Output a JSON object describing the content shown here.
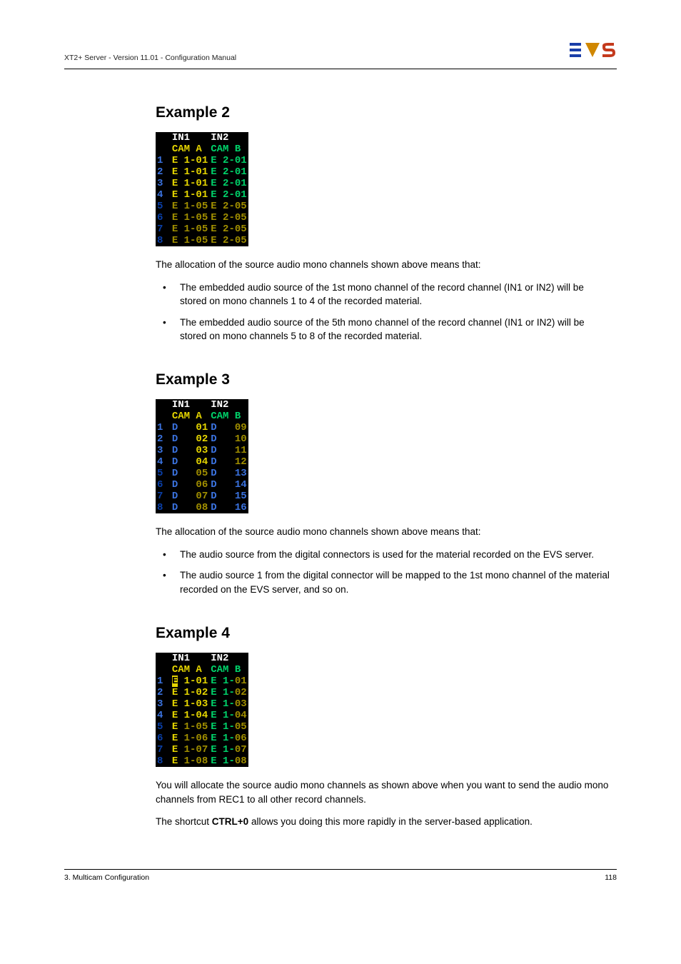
{
  "header": {
    "title": "XT2+ Server - Version 11.01 - Configuration Manual"
  },
  "footer": {
    "left": "3. Multicam Configuration",
    "right": "118"
  },
  "ex2": {
    "title": "Example 2",
    "head_in1": "IN1",
    "head_in2": "IN2",
    "cam_a": "CAM A",
    "cam_b": "CAM B",
    "rows": [
      {
        "n": "1",
        "a": "E 1-01",
        "b": "E 2-01",
        "g": true
      },
      {
        "n": "2",
        "a": "E 1-01",
        "b": "E 2-01",
        "g": true
      },
      {
        "n": "3",
        "a": "E 1-01",
        "b": "E 2-01",
        "g": true
      },
      {
        "n": "4",
        "a": "E 1-01",
        "b": "E 2-01",
        "g": true
      },
      {
        "n": "5",
        "a": "E 1-05",
        "b": "E 2-05",
        "g": false
      },
      {
        "n": "6",
        "a": "E 1-05",
        "b": "E 2-05",
        "g": false
      },
      {
        "n": "7",
        "a": "E 1-05",
        "b": "E 2-05",
        "g": false
      },
      {
        "n": "8",
        "a": "E 1-05",
        "b": "E 2-05",
        "g": false
      }
    ],
    "intro": "The allocation of the source audio mono channels shown above means that:",
    "b1": "The embedded audio source of the 1st mono channel of the record channel (IN1 or IN2) will be stored on mono channels 1 to 4 of the recorded material.",
    "b2": "The embedded audio source of the 5th mono channel of the record channel (IN1 or IN2) will be stored on mono channels 5 to 8 of the recorded material."
  },
  "ex3": {
    "title": "Example 3",
    "head_in1": "IN1",
    "head_in2": "IN2",
    "cam_a": "CAM A",
    "cam_b": "CAM B",
    "rows": [
      {
        "n": "1",
        "a": "D   01",
        "b": "D   09"
      },
      {
        "n": "2",
        "a": "D   02",
        "b": "D   10"
      },
      {
        "n": "3",
        "a": "D   03",
        "b": "D   11"
      },
      {
        "n": "4",
        "a": "D   04",
        "b": "D   12"
      },
      {
        "n": "5",
        "a": "D   05",
        "b": "D   13"
      },
      {
        "n": "6",
        "a": "D   06",
        "b": "D   14"
      },
      {
        "n": "7",
        "a": "D   07",
        "b": "D   15"
      },
      {
        "n": "8",
        "a": "D   08",
        "b": "D   16"
      }
    ],
    "intro": "The allocation of the source audio mono channels shown above means that:",
    "b1": "The audio source from the digital connectors is used for the material recorded on the EVS server.",
    "b2": "The audio source 1 from the digital connector will be mapped to the 1st mono channel of the material recorded on the EVS server, and so on."
  },
  "ex4": {
    "title": "Example 4",
    "head_in1": "IN1",
    "head_in2": "IN2",
    "cam_a": "CAM A",
    "cam_b": "CAM B",
    "rows": [
      {
        "n": "1",
        "aE": "E",
        "aRest": " 1-01",
        "b3": "E 1-",
        "b4": "01",
        "hl": true
      },
      {
        "n": "2",
        "aE": "E",
        "aRest": " 1-02",
        "b3": "E 1-",
        "b4": "02"
      },
      {
        "n": "3",
        "aE": "E",
        "aRest": " 1-03",
        "b3": "E 1-",
        "b4": "03"
      },
      {
        "n": "4",
        "aE": "E",
        "aRest": " 1-04",
        "b3": "E 1-",
        "b4": "04"
      },
      {
        "n": "5",
        "aE": "E",
        "aRest": " 1-05",
        "b3": "E 1-",
        "b4": "05"
      },
      {
        "n": "6",
        "aE": "E",
        "aRest": " 1-06",
        "b3": "E 1-",
        "b4": "06"
      },
      {
        "n": "7",
        "aE": "E",
        "aRest": " 1-07",
        "b3": "E 1-",
        "b4": "07"
      },
      {
        "n": "8",
        "aE": "E",
        "aRest": " 1-08",
        "b3": "E 1-",
        "b4": "08"
      }
    ],
    "p1": "You will allocate the source audio mono channels as shown above when you want to send the audio mono channels from REC1 to all other record channels.",
    "p2a": "The shortcut ",
    "p2b": "CTRL+0",
    "p2c": " allows you doing this more rapidly in the server-based application."
  }
}
